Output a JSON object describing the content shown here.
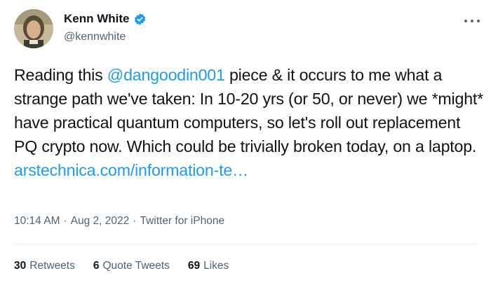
{
  "author": {
    "display_name": "Kenn White",
    "handle": "@kennwhite",
    "verified": true
  },
  "tweet": {
    "text_before": "Reading this ",
    "mention": "@dangoodin001",
    "text_after": " piece & it occurs to me what a strange path we've taken: In 10-20 yrs (or 50, or never) we *might* have practical quantum computers, so let's roll out replacement PQ crypto now. Which could be trivially broken today, on a laptop.\n",
    "link": "arstechnica.com/information-te…"
  },
  "meta": {
    "time": "10:14 AM",
    "sep1": "·",
    "date": "Aug 2, 2022",
    "sep2": "·",
    "source": "Twitter for iPhone"
  },
  "stats": {
    "retweets_count": "30",
    "retweets_label": "Retweets",
    "quotes_count": "6",
    "quotes_label": "Quote Tweets",
    "likes_count": "69",
    "likes_label": "Likes"
  },
  "colors": {
    "accent": "#1d9bf0",
    "text": "#0f1419",
    "secondary": "#536471"
  },
  "icons": {
    "verified": "verified-badge-icon",
    "more": "more-options-icon"
  }
}
